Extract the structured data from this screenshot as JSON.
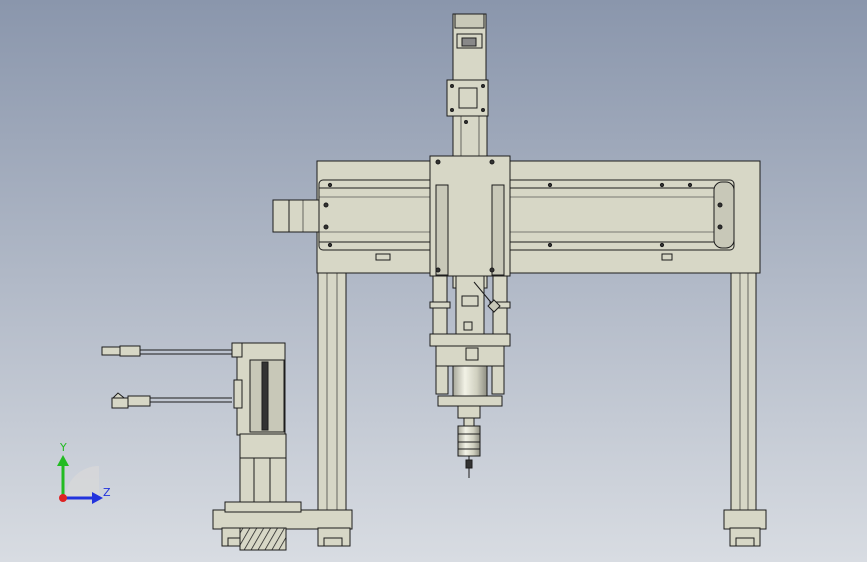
{
  "view": {
    "background_top": "#8a96ac",
    "background_bottom": "#d8dce2",
    "part_fill": "#d7d7c6",
    "part_fill_dark": "#bcbcac",
    "edge_color": "#1c1c1c",
    "accent_gold": "#c8a040"
  },
  "triad": {
    "y_label": "Y",
    "z_label": "Z",
    "y_color": "#22bb22",
    "z_color": "#2233dd",
    "x_color": "#dd2222"
  }
}
